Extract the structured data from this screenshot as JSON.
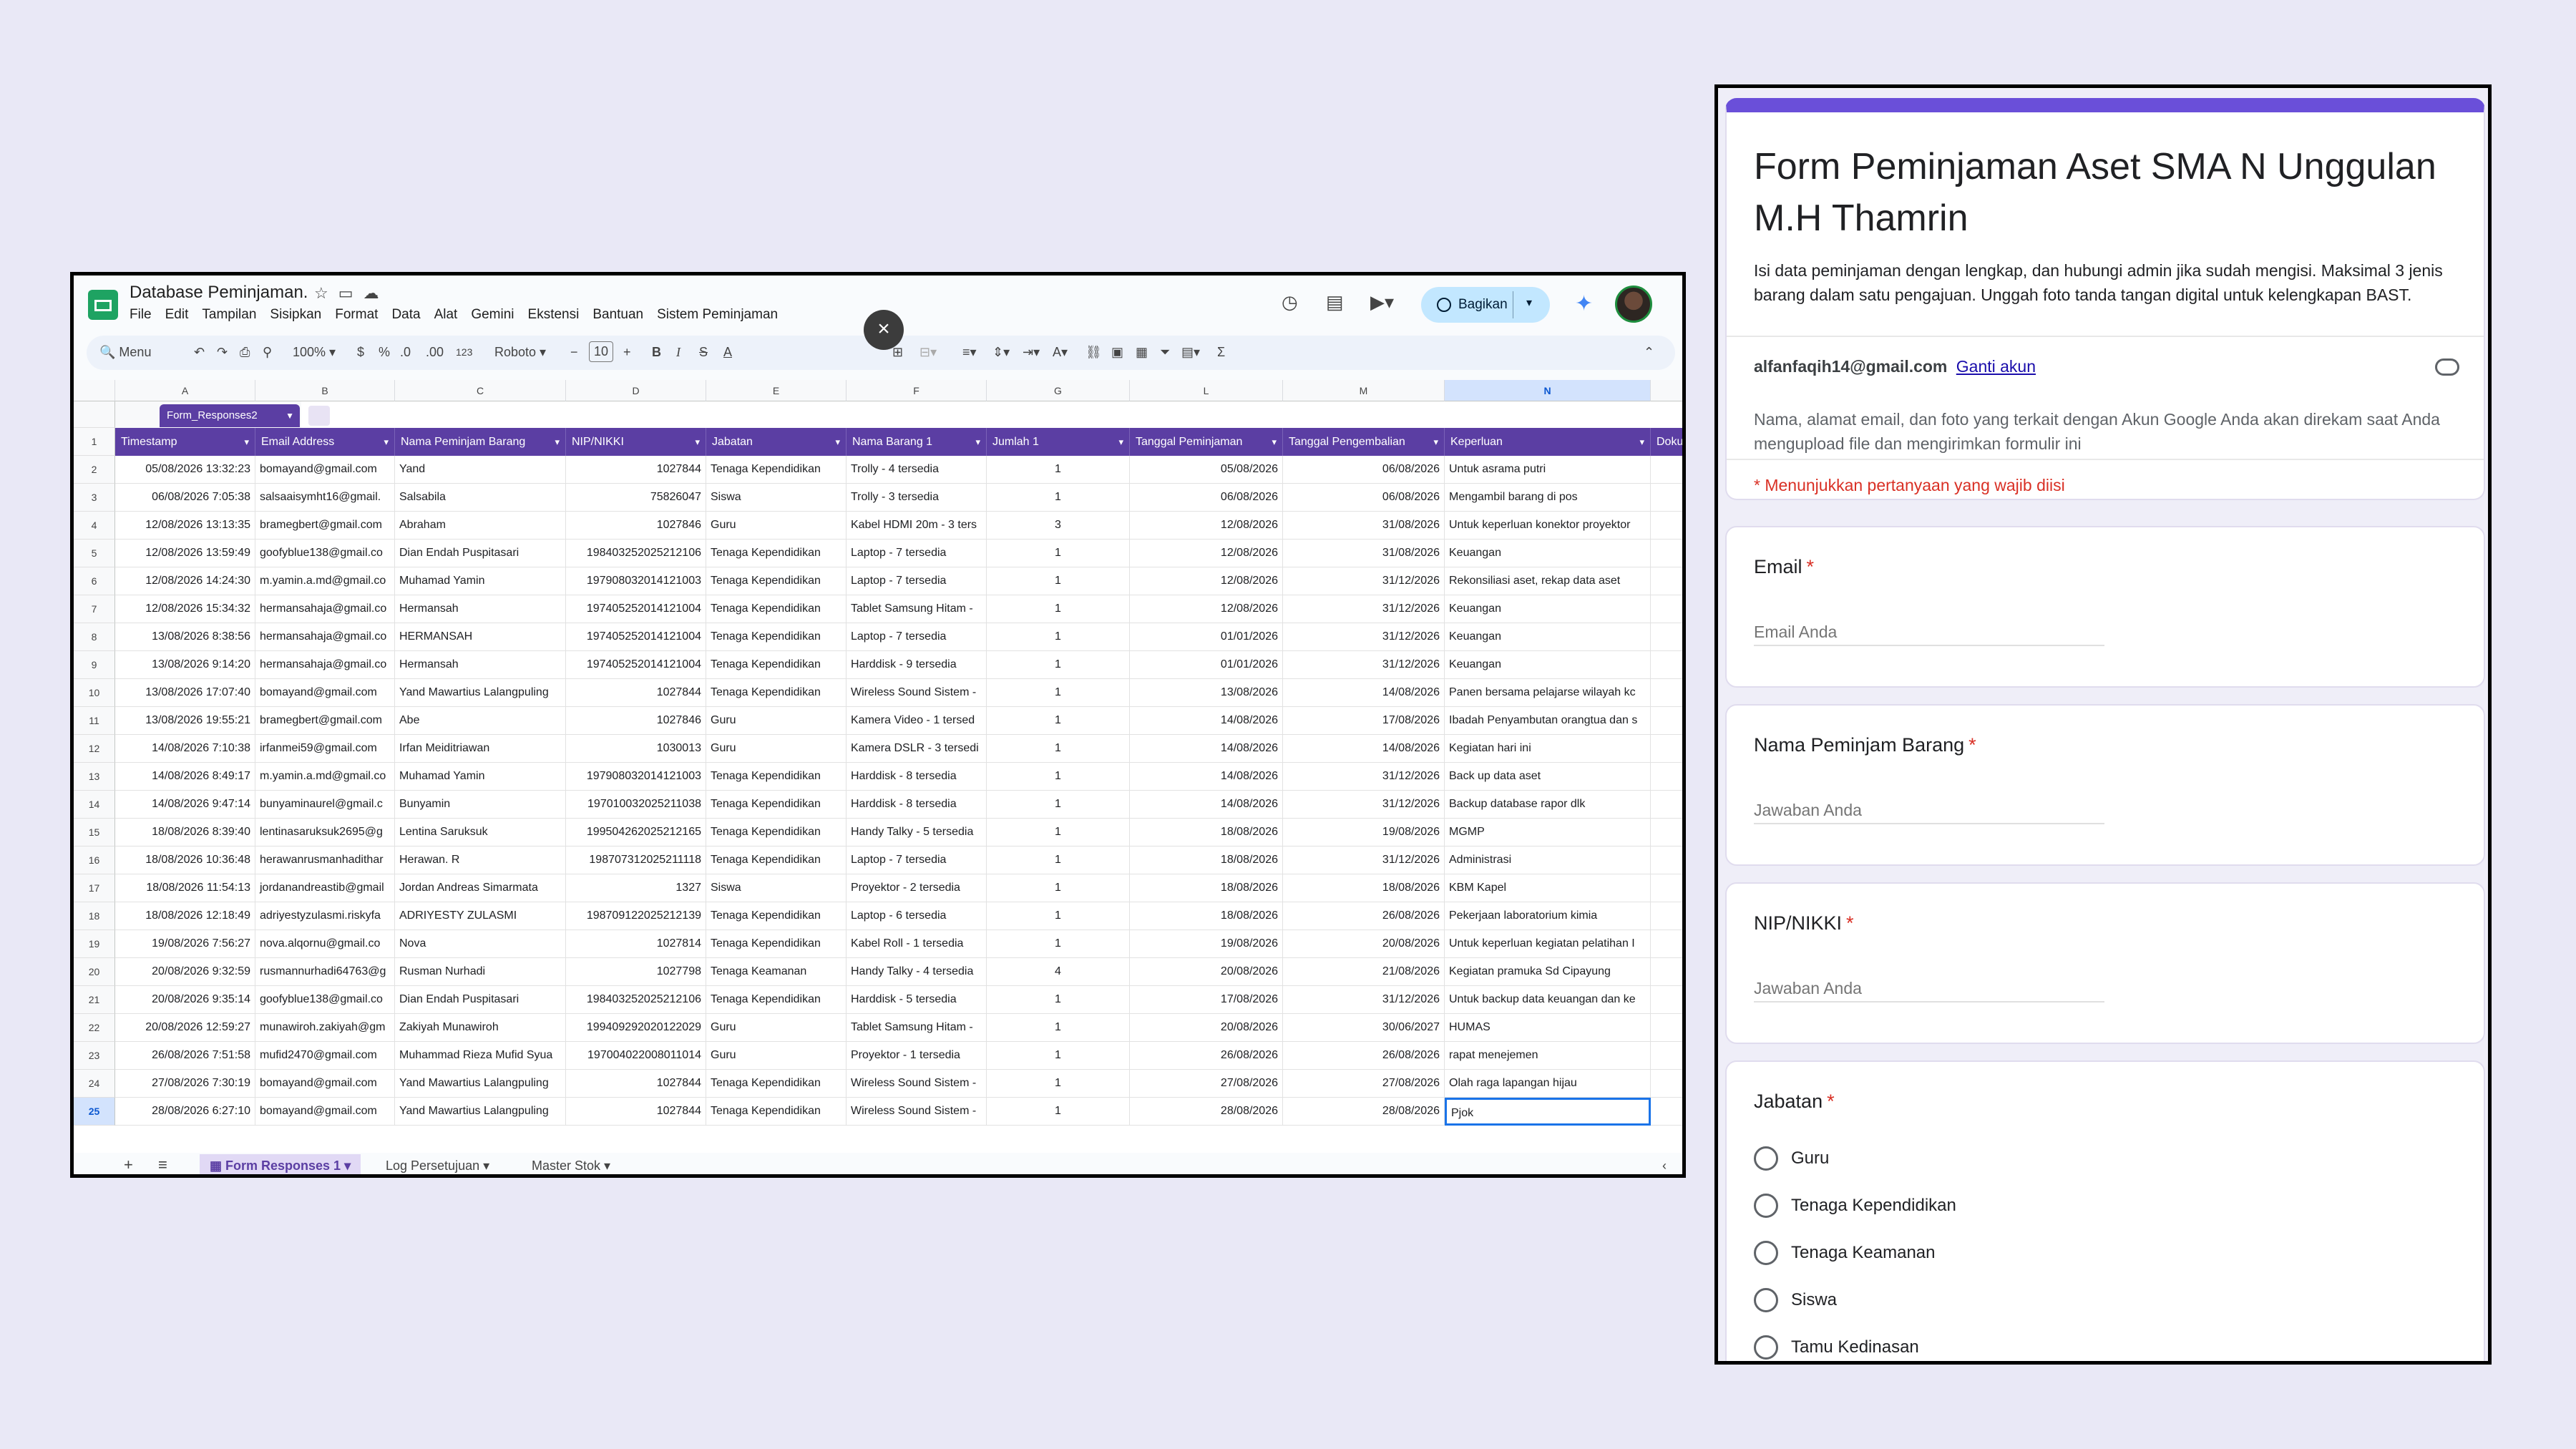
{
  "sheets": {
    "title": "Database Peminjaman.",
    "menu": [
      "File",
      "Edit",
      "Tampilan",
      "Sisipkan",
      "Format",
      "Data",
      "Alat",
      "Gemini",
      "Ekstensi",
      "Bantuan",
      "Sistem Peminjaman"
    ],
    "share_label": "Bagikan",
    "toolbar": {
      "search": "Menu",
      "zoom": "100%",
      "currency": "$",
      "percent": "%",
      "dec_dec": ".0",
      "inc_dec": ".00",
      "number_fmt": "123",
      "font": "Roboto",
      "font_size": "10"
    },
    "table_name": "Form_Responses2",
    "col_letters": [
      "A",
      "B",
      "C",
      "D",
      "E",
      "F",
      "G",
      "L",
      "M",
      "N"
    ],
    "headers": [
      "Timestamp",
      "Email Address",
      "Nama Peminjam Barang",
      "NIP/NIKKI",
      "Jabatan",
      "Nama Barang 1",
      "Jumlah 1",
      "Tanggal Peminjaman",
      "Tanggal Pengembalian",
      "Keperluan",
      "Doku"
    ],
    "rows": [
      [
        "05/08/2026 13:32:23",
        "bomayand@gmail.com",
        "Yand",
        "1027844",
        "Tenaga Kependidikan",
        "Trolly - 4 tersedia",
        "1",
        "05/08/2026",
        "06/08/2026",
        "Untuk asrama putri"
      ],
      [
        "06/08/2026 7:05:38",
        "salsaaisymht16@gmail.",
        "Salsabila",
        "75826047",
        "Siswa",
        "Trolly - 3 tersedia",
        "1",
        "06/08/2026",
        "06/08/2026",
        "Mengambil barang di pos"
      ],
      [
        "12/08/2026 13:13:35",
        "bramegbert@gmail.com",
        "Abraham",
        "1027846",
        "Guru",
        "Kabel HDMI 20m - 3 ters",
        "3",
        "12/08/2026",
        "31/08/2026",
        "Untuk keperluan konektor proyektor"
      ],
      [
        "12/08/2026 13:59:49",
        "goofyblue138@gmail.co",
        "Dian Endah Puspitasari",
        "198403252025212106",
        "Tenaga Kependidikan",
        "Laptop - 7 tersedia",
        "1",
        "12/08/2026",
        "31/08/2026",
        "Keuangan"
      ],
      [
        "12/08/2026 14:24:30",
        "m.yamin.a.md@gmail.co",
        "Muhamad Yamin",
        "197908032014121003",
        "Tenaga Kependidikan",
        "Laptop - 7 tersedia",
        "1",
        "12/08/2026",
        "31/12/2026",
        "Rekonsiliasi aset, rekap data aset"
      ],
      [
        "12/08/2026 15:34:32",
        "hermansahaja@gmail.co",
        "Hermansah",
        "197405252014121004",
        "Tenaga Kependidikan",
        "Tablet Samsung Hitam -",
        "1",
        "12/08/2026",
        "31/12/2026",
        "Keuangan"
      ],
      [
        "13/08/2026 8:38:56",
        "hermansahaja@gmail.co",
        "HERMANSAH",
        "197405252014121004",
        "Tenaga Kependidikan",
        "Laptop - 7 tersedia",
        "1",
        "01/01/2026",
        "31/12/2026",
        "Keuangan"
      ],
      [
        "13/08/2026 9:14:20",
        "hermansahaja@gmail.co",
        "Hermansah",
        "197405252014121004",
        "Tenaga Kependidikan",
        "Harddisk - 9 tersedia",
        "1",
        "01/01/2026",
        "31/12/2026",
        "Keuangan"
      ],
      [
        "13/08/2026 17:07:40",
        "bomayand@gmail.com",
        "Yand Mawartius Lalangpuling",
        "1027844",
        "Tenaga Kependidikan",
        "Wireless Sound Sistem -",
        "1",
        "13/08/2026",
        "14/08/2026",
        "Panen bersama pelajarse wilayah kc"
      ],
      [
        "13/08/2026 19:55:21",
        "bramegbert@gmail.com",
        "Abe",
        "1027846",
        "Guru",
        "Kamera Video - 1 tersed",
        "1",
        "14/08/2026",
        "17/08/2026",
        "Ibadah Penyambutan orangtua dan s"
      ],
      [
        "14/08/2026 7:10:38",
        "irfanmei59@gmail.com",
        "Irfan Meiditriawan",
        "1030013",
        "Guru",
        "Kamera DSLR - 3 tersedi",
        "1",
        "14/08/2026",
        "14/08/2026",
        "Kegiatan hari ini"
      ],
      [
        "14/08/2026 8:49:17",
        "m.yamin.a.md@gmail.co",
        "Muhamad Yamin",
        "197908032014121003",
        "Tenaga Kependidikan",
        "Harddisk - 8 tersedia",
        "1",
        "14/08/2026",
        "31/12/2026",
        "Back up data aset"
      ],
      [
        "14/08/2026 9:47:14",
        "bunyaminaurel@gmail.c",
        "Bunyamin",
        "197010032025211038",
        "Tenaga Kependidikan",
        "Harddisk - 8 tersedia",
        "1",
        "14/08/2026",
        "31/12/2026",
        "Backup database rapor dlk"
      ],
      [
        "18/08/2026 8:39:40",
        "lentinasaruksuk2695@g",
        "Lentina Saruksuk",
        "199504262025212165",
        "Tenaga Kependidikan",
        "Handy Talky - 5 tersedia",
        "1",
        "18/08/2026",
        "19/08/2026",
        "MGMP"
      ],
      [
        "18/08/2026 10:36:48",
        "herawanrusmanhadithar",
        "Herawan. R",
        "198707312025211118",
        "Tenaga Kependidikan",
        "Laptop - 7 tersedia",
        "1",
        "18/08/2026",
        "31/12/2026",
        "Administrasi"
      ],
      [
        "18/08/2026 11:54:13",
        "jordanandreastib@gmail",
        "Jordan Andreas Simarmata",
        "1327",
        "Siswa",
        "Proyektor - 2 tersedia",
        "1",
        "18/08/2026",
        "18/08/2026",
        "KBM Kapel"
      ],
      [
        "18/08/2026 12:18:49",
        "adriyestyzulasmi.riskyfa",
        "ADRIYESTY ZULASMI",
        "198709122025212139",
        "Tenaga Kependidikan",
        "Laptop - 6 tersedia",
        "1",
        "18/08/2026",
        "26/08/2026",
        "Pekerjaan laboratorium kimia"
      ],
      [
        "19/08/2026 7:56:27",
        "nova.alqornu@gmail.co",
        "Nova",
        "1027814",
        "Tenaga Kependidikan",
        "Kabel Roll - 1 tersedia",
        "1",
        "19/08/2026",
        "20/08/2026",
        "Untuk keperluan kegiatan pelatihan I"
      ],
      [
        "20/08/2026 9:32:59",
        "rusmannurhadi64763@g",
        "Rusman Nurhadi",
        "1027798",
        "Tenaga Keamanan",
        "Handy Talky - 4 tersedia",
        "4",
        "20/08/2026",
        "21/08/2026",
        "Kegiatan pramuka Sd Cipayung"
      ],
      [
        "20/08/2026 9:35:14",
        "goofyblue138@gmail.co",
        "Dian Endah Puspitasari",
        "198403252025212106",
        "Tenaga Kependidikan",
        "Harddisk - 5 tersedia",
        "1",
        "17/08/2026",
        "31/12/2026",
        "Untuk backup data keuangan dan ke"
      ],
      [
        "20/08/2026 12:59:27",
        "munawiroh.zakiyah@gm",
        "Zakiyah Munawiroh",
        "199409292020122029",
        "Guru",
        "Tablet Samsung Hitam -",
        "1",
        "20/08/2026",
        "30/06/2027",
        "HUMAS"
      ],
      [
        "26/08/2026 7:51:58",
        "mufid2470@gmail.com",
        "Muhammad Rieza Mufid Syua",
        "197004022008011014",
        "Guru",
        "Proyektor - 1 tersedia",
        "1",
        "26/08/2026",
        "26/08/2026",
        "rapat menejemen"
      ],
      [
        "27/08/2026 7:30:19",
        "bomayand@gmail.com",
        "Yand Mawartius Lalangpuling",
        "1027844",
        "Tenaga Kependidikan",
        "Wireless Sound Sistem -",
        "1",
        "27/08/2026",
        "27/08/2026",
        "Olah raga lapangan hijau"
      ],
      [
        "28/08/2026 6:27:10",
        "bomayand@gmail.com",
        "Yand Mawartius Lalangpuling",
        "1027844",
        "Tenaga Kependidikan",
        "Wireless Sound Sistem -",
        "1",
        "28/08/2026",
        "28/08/2026",
        "Pjok"
      ]
    ],
    "sheet_tabs": [
      "Form Responses 1",
      "Log Persetujuan",
      "Master Stok"
    ]
  },
  "form": {
    "title": "Form Peminjaman Aset SMA N Unggulan M.H Thamrin",
    "description": "Isi data peminjaman dengan lengkap, dan hubungi admin jika sudah mengisi. Maksimal 3 jenis barang dalam satu pengajuan. Unggah foto tanda tangan digital untuk kelengkapan BAST.",
    "account_email": "alfanfaqih14@gmail.com",
    "switch_account": "Ganti akun",
    "privacy_note": "Nama, alamat email, dan foto yang terkait dengan Akun Google Anda akan direkam saat Anda mengupload file dan mengirimkan formulir ini",
    "required_note": "* Menunjukkan pertanyaan yang wajib diisi",
    "q_email": {
      "label": "Email",
      "placeholder": "Email Anda"
    },
    "q_nama": {
      "label": "Nama Peminjam Barang",
      "placeholder": "Jawaban Anda"
    },
    "q_nip": {
      "label": "NIP/NIKKI",
      "placeholder": "Jawaban Anda"
    },
    "q_jabatan": {
      "label": "Jabatan",
      "options": [
        "Guru",
        "Tenaga Kependidikan",
        "Tenaga Keamanan",
        "Siswa",
        "Tamu Kedinasan"
      ]
    }
  }
}
